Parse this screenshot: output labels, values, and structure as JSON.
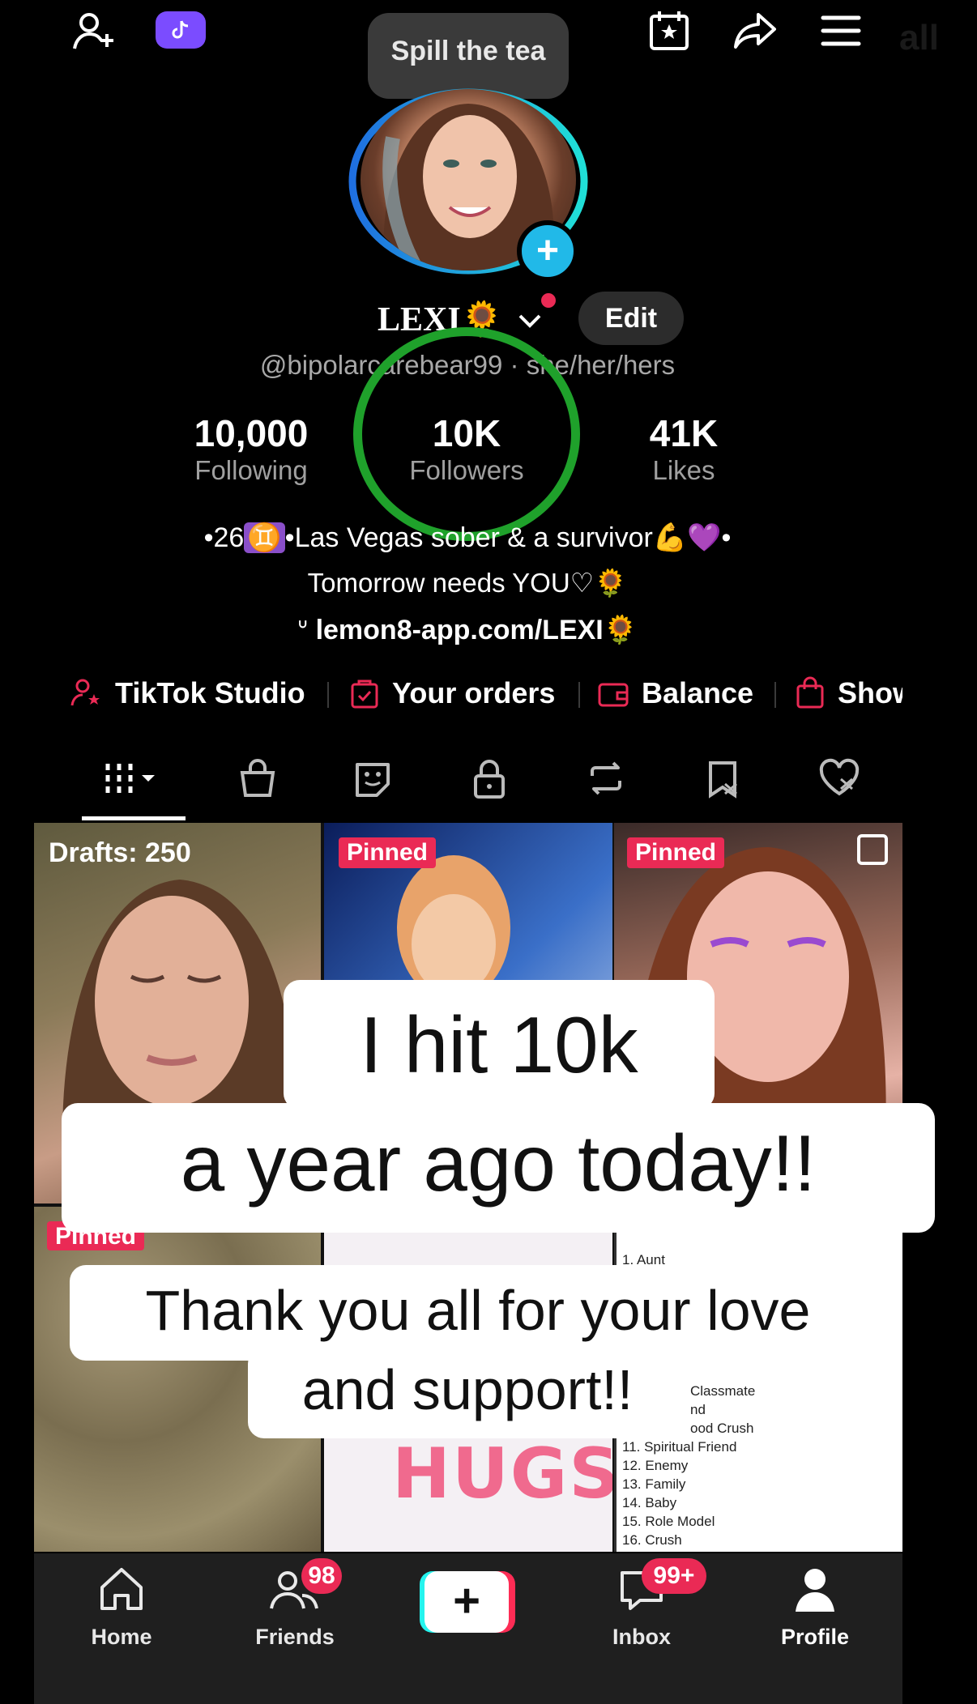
{
  "top_bar": {
    "tooltip": "Spill the tea",
    "status_partial": "all",
    "icons": [
      "add-user-icon",
      "tiktok-icon",
      "calendar-star-icon",
      "share-icon",
      "menu-icon"
    ]
  },
  "profile": {
    "name": "LEXI",
    "name_emoji": "🌻",
    "handle": "@bipolarcarebear99 · she/her/hers",
    "edit_label": "Edit",
    "stats": [
      {
        "value": "10,000",
        "label": "Following"
      },
      {
        "value": "10K",
        "label": "Followers"
      },
      {
        "value": "41K",
        "label": "Likes"
      }
    ],
    "bio_line1_prefix": "•26",
    "bio_line1_sign": "♊",
    "bio_line1_rest": "•Las Vegas sober & a survivor",
    "bio_line1_emojis": "💪💜•",
    "bio_line2": "Tomorrow needs YOU♡🌻",
    "bio_link": "lemon8-app.com/LEXI🌻"
  },
  "quick_links": [
    {
      "label": "TikTok Studio",
      "icon": "person-star-icon"
    },
    {
      "label": "Your orders",
      "icon": "bag-check-icon"
    },
    {
      "label": "Balance",
      "icon": "wallet-icon"
    },
    {
      "label": "Show",
      "icon": "shopping-bag-icon"
    }
  ],
  "tabs": [
    "grid-icon",
    "shop-icon",
    "sticker-icon",
    "lock-icon",
    "repost-icon",
    "saved-icon",
    "liked-icon"
  ],
  "grid": {
    "drafts_label": "Drafts: 250",
    "pinned_label": "Pinned",
    "hugs_text": "HUGS",
    "list_items": [
      "1. Aunt",
      "Classmate",
      "nd",
      "ood Crush",
      "11. Spiritual Friend",
      "12. Enemy",
      "13. Family",
      "14. Baby",
      "15. Role Model",
      "16. Crush"
    ]
  },
  "overlay": {
    "line1": "I hit 10k",
    "line2": "a year ago today!!",
    "line3": "Thank you all for your love",
    "line4": "and support!!"
  },
  "nav": {
    "items": [
      {
        "label": "Home",
        "icon": "home-icon"
      },
      {
        "label": "Friends",
        "icon": "friends-icon",
        "badge": "98"
      },
      {
        "label": "",
        "icon": "create-plus-icon"
      },
      {
        "label": "Inbox",
        "icon": "inbox-icon",
        "badge": "99+"
      },
      {
        "label": "Profile",
        "icon": "profile-icon"
      }
    ]
  },
  "colors": {
    "accent_red": "#ea2a55",
    "ring_cyan": "#21b9e8",
    "circle_green": "#1fa12b",
    "tiktok_purple": "#7b4cff"
  }
}
